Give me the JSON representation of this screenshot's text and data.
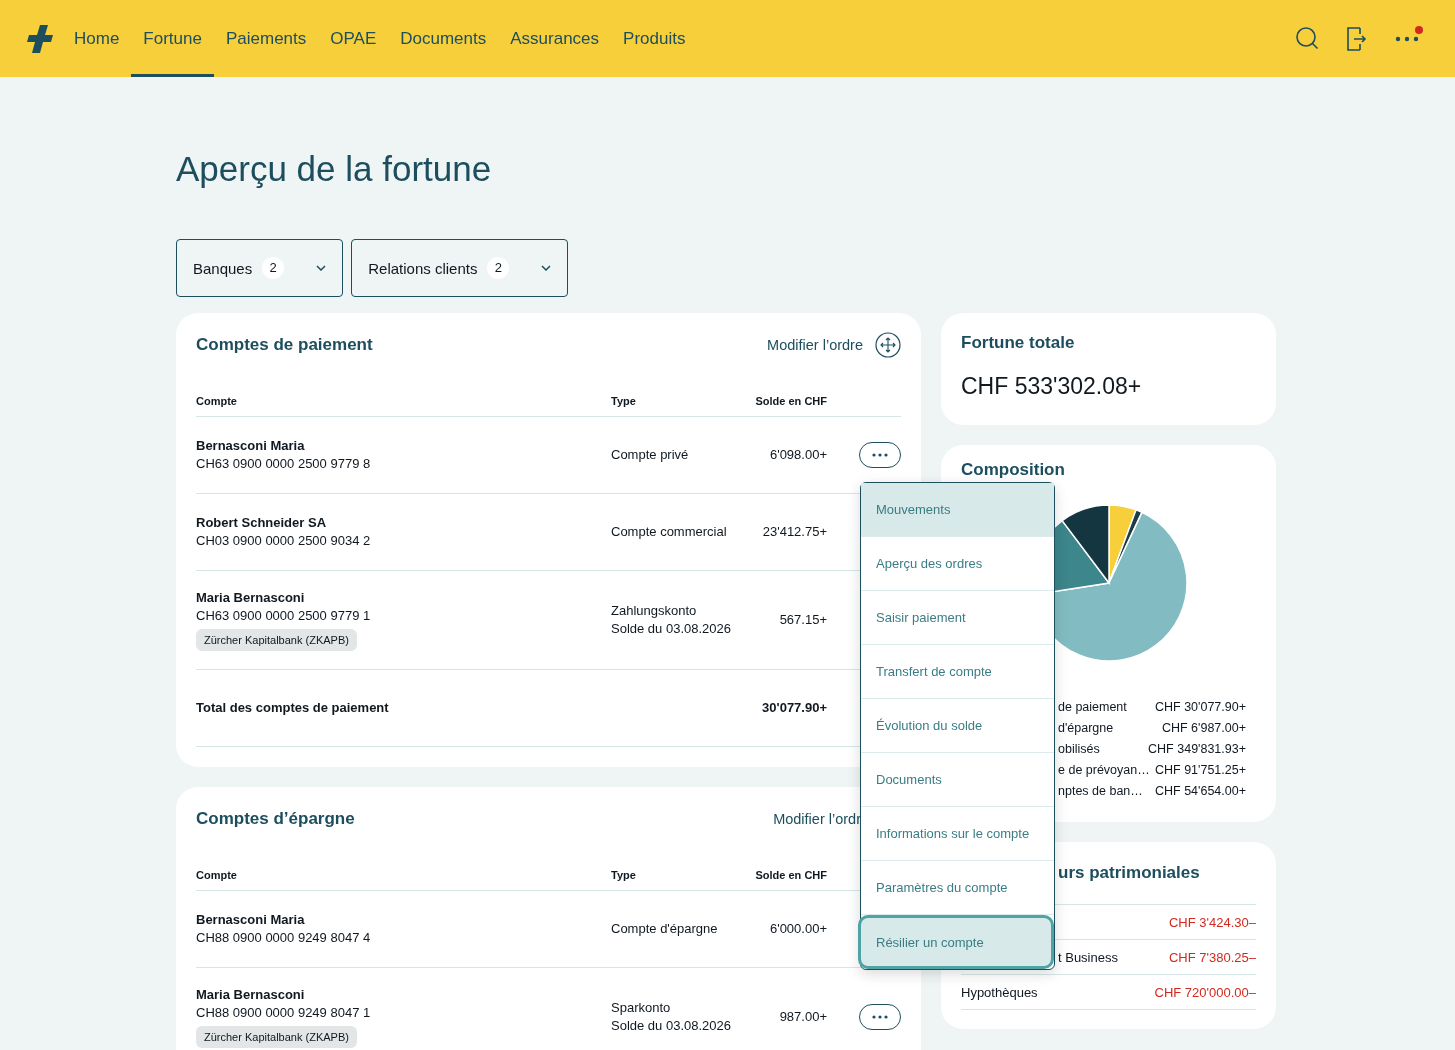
{
  "header": {
    "tabs": [
      {
        "label": "Home",
        "selected": false
      },
      {
        "label": "Fortune",
        "selected": true
      },
      {
        "label": "Paiements",
        "selected": false
      },
      {
        "label": "OPAE",
        "selected": false
      },
      {
        "label": "Documents",
        "selected": false
      },
      {
        "label": "Assurances",
        "selected": false
      },
      {
        "label": "Produits",
        "selected": false
      }
    ],
    "notification": true
  },
  "page_title": "Aperçu de la fortune",
  "filters": [
    {
      "label": "Banques",
      "count": "2"
    },
    {
      "label": "Relations clients",
      "count": "2"
    }
  ],
  "payment_accounts": {
    "title": "Comptes de paiement",
    "reorder": "Modifier l’ordre",
    "reorder_icon": true,
    "columns": [
      "Compte",
      "Type",
      "Solde en CHF"
    ],
    "rows": [
      {
        "name": "Bernasconi Maria",
        "iban": "CH63 0900 0000 2500 9779 8",
        "type": "Compte privé",
        "balance": "6'098.00+",
        "actions": true
      },
      {
        "name": "Robert Schneider SA",
        "iban": "CH03 0900 0000 2500 9034 2",
        "type": "Compte commercial",
        "balance": "23'412.75+"
      },
      {
        "name": "Maria Bernasconi",
        "iban": "CH63 0900 0000 2500 9779 1",
        "bank": "Zürcher Kapitalbank (ZKAPB)",
        "type": "Zahlungskonto",
        "type_note": "Solde du 03.08.2026",
        "balance": "567.15+"
      }
    ],
    "total": {
      "label": "Total des comptes de paiement",
      "value": "30'077.90+"
    }
  },
  "savings_accounts": {
    "title": "Comptes d’épargne",
    "reorder": "Modifier l’ordr",
    "reorder_icon": false,
    "columns": [
      "Compte",
      "Type",
      "Solde en CHF"
    ],
    "rows": [
      {
        "name": "Bernasconi Maria",
        "iban": "CH88 0900 0000 9249 8047 4",
        "type": "Compte d'épargne",
        "balance": "6'000.00+"
      },
      {
        "name": "Maria Bernasconi",
        "iban": "CH88 0900 0000 9249 8047 1",
        "bank": "Zürcher Kapitalbank (ZKAPB)",
        "type": "Sparkonto",
        "type_note": "Solde du 03.08.2026",
        "balance": "987.00+",
        "actions": true
      }
    ]
  },
  "total_wealth": {
    "title": "Fortune totale",
    "value": "CHF 533'302.08+"
  },
  "composition": {
    "title": "Composition",
    "chart_data": {
      "type": "pie",
      "values": [
        5.64,
        1.31,
        65.6,
        17.2,
        10.25
      ],
      "colors": [
        "#f7cf3b",
        "#1a3d48",
        "#82bcc2",
        "#3c868c",
        "#143641"
      ]
    },
    "legend": [
      {
        "label": "de paiement",
        "value": "CHF 30'077.90+"
      },
      {
        "label": "d'épargne",
        "value": "CHF 6'987.00+"
      },
      {
        "label": "obilisés",
        "value": "CHF 349'831.93+"
      },
      {
        "label": "e de prévoyan…",
        "value": "CHF 91'751.25+"
      },
      {
        "label": "nptes de ban…",
        "value": "CHF 54'654.00+"
      }
    ]
  },
  "liabilities": {
    "title": "urs patrimoniales",
    "title_covered": true,
    "rows": [
      {
        "value": "CHF 3'424.30–"
      },
      {
        "label": "t Business",
        "value": "CHF 7'380.25–",
        "covered": true
      },
      {
        "label": "Hypothèques",
        "value": "CHF 720'000.00–",
        "covered": false
      }
    ]
  },
  "menu": {
    "items": [
      {
        "label": "Mouvements",
        "hovered": true,
        "focused": false
      },
      {
        "label": "Aperçu des ordres",
        "hovered": false,
        "focused": false
      },
      {
        "label": "Saisir paiement",
        "hovered": false,
        "focused": false
      },
      {
        "label": "Transfert de compte",
        "hovered": false,
        "focused": false
      },
      {
        "label": "Évolution du solde",
        "hovered": false,
        "focused": false
      },
      {
        "label": "Documents",
        "hovered": false,
        "focused": false
      },
      {
        "label": "Informations sur le compte",
        "hovered": false,
        "focused": false
      },
      {
        "label": "Paramètres du compte",
        "hovered": false,
        "focused": false
      },
      {
        "label": "Résilier un compte",
        "hovered": false,
        "focused": true
      }
    ]
  }
}
